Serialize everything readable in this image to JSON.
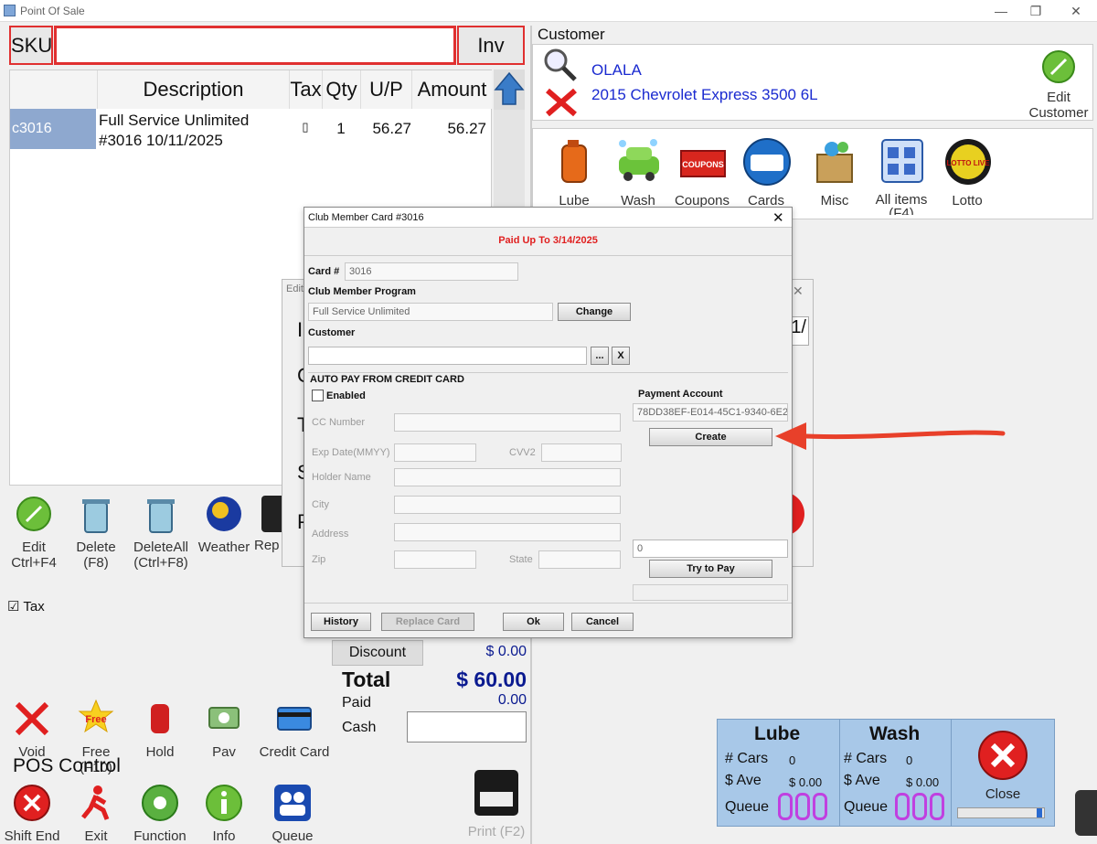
{
  "window": {
    "title": "Point Of Sale",
    "min": "—",
    "max": "❐",
    "close": "✕"
  },
  "sku": {
    "label": "SKU",
    "value": "",
    "inv_label": "Inv"
  },
  "table": {
    "headers": {
      "description": "Description",
      "tax": "Tax",
      "qty": "Qty",
      "up": "U/P",
      "amount": "Amount"
    },
    "rows": [
      {
        "sku": "c3016",
        "description_line1": "Full Service Unlimited",
        "description_line2": "#3016 10/11/2025",
        "tax": "▯",
        "qty": "1",
        "up": "56.27",
        "amount": "56.27"
      }
    ]
  },
  "customer": {
    "title": "Customer",
    "name": "OLALA",
    "vehicle": "2015 Chevrolet Express 3500 6L",
    "edit_label_1": "Edit",
    "edit_label_2": "Customer"
  },
  "categories": [
    {
      "label": "Lube",
      "icon": "lube-icon"
    },
    {
      "label": "Wash",
      "icon": "wash-icon"
    },
    {
      "label": "Coupons",
      "icon": "coupons-icon"
    },
    {
      "label": "Cards",
      "icon": "cards-icon"
    },
    {
      "label": "Misc",
      "icon": "misc-icon"
    },
    {
      "label": "All items",
      "sub": "(F4)",
      "icon": "all-items-icon"
    },
    {
      "label": "Lotto",
      "icon": "lotto-icon"
    }
  ],
  "coupons_badge": "COUPONS",
  "lotto_badge": "LOTTO LIVE",
  "actions": [
    {
      "label1": "Edit",
      "label2": "Ctrl+F4"
    },
    {
      "label1": "Delete",
      "label2": "(F8)"
    },
    {
      "label1": "DeleteAll",
      "label2": "(Ctrl+F8)"
    },
    {
      "label1": "Weather",
      "label2": ""
    },
    {
      "label1": "Rep",
      "label2": ""
    }
  ],
  "tax_check": {
    "mark": "☑",
    "label": "Tax"
  },
  "totals": {
    "discount_label": "Discount",
    "discount_value": "$ 0.00",
    "total_label": "Total",
    "total_value": "$ 60.00",
    "paid_label": "Paid",
    "paid_value": "0.00",
    "cash_label": "Cash",
    "cash_value": ""
  },
  "pos_actions": [
    {
      "label": "Void"
    },
    {
      "label": "Free (F10)"
    },
    {
      "label": "Hold"
    },
    {
      "label": "Pav"
    },
    {
      "label": "Credit Card"
    }
  ],
  "free_badge": "Free",
  "pos_control": {
    "title": "POS Control",
    "items": [
      {
        "label": "Shift End"
      },
      {
        "label": "Exit"
      },
      {
        "label": "Function"
      },
      {
        "label": "Info"
      },
      {
        "label": "Queue"
      }
    ]
  },
  "print": {
    "label": "Print (F2)"
  },
  "stats": {
    "lube": {
      "title": "Lube",
      "cars_label": "# Cars",
      "cars": "0",
      "ave_label": "$ Ave",
      "ave": "$ 0.00",
      "queue_label": "Queue"
    },
    "wash": {
      "title": "Wash",
      "cars_label": "# Cars",
      "cars": "0",
      "ave_label": "$ Ave",
      "ave": "$ 0.00",
      "queue_label": "Queue"
    },
    "close_label": "Close"
  },
  "behind_dialog": {
    "title": "Edit",
    "letters": [
      "I",
      "C",
      "T",
      "S",
      "P"
    ],
    "fragment": "1/",
    "close": "✕"
  },
  "dialog": {
    "title": "Club Member Card #3016",
    "close": "✕",
    "paid_up": "Paid Up To 3/14/2025",
    "card_label": "Card #",
    "card_value": "3016",
    "program_label": "Club Member Program",
    "program_value": "Full Service Unlimited",
    "change_btn": "Change",
    "customer_label": "Customer",
    "customer_value": "",
    "browse_btn": "...",
    "clear_btn": "X",
    "autopay_label": "AUTO PAY FROM CREDIT CARD",
    "enabled_label": "Enabled",
    "cc_label": "CC Number",
    "exp_label": "Exp Date(MMYY)",
    "cvv_label": "CVV2",
    "holder_label": "Holder Name",
    "city_label": "City",
    "address_label": "Address",
    "zip_label": "Zip",
    "state_label": "State",
    "payment_account_label": "Payment Account",
    "payment_account_value": "78DD38EF-E014-45C1-9340-6E2",
    "create_btn": "Create",
    "amount_value": "0",
    "try_pay_btn": "Try to Pay",
    "history_btn": "History",
    "replace_btn": "Replace Card",
    "ok_btn": "Ok",
    "cancel_btn": "Cancel"
  },
  "colors": {
    "red": "#e03030",
    "blue_text": "#1a2ad0",
    "navy": "#0a1a90",
    "stats_bg": "#a8c8e8",
    "queue_digit": "#c040e0"
  }
}
